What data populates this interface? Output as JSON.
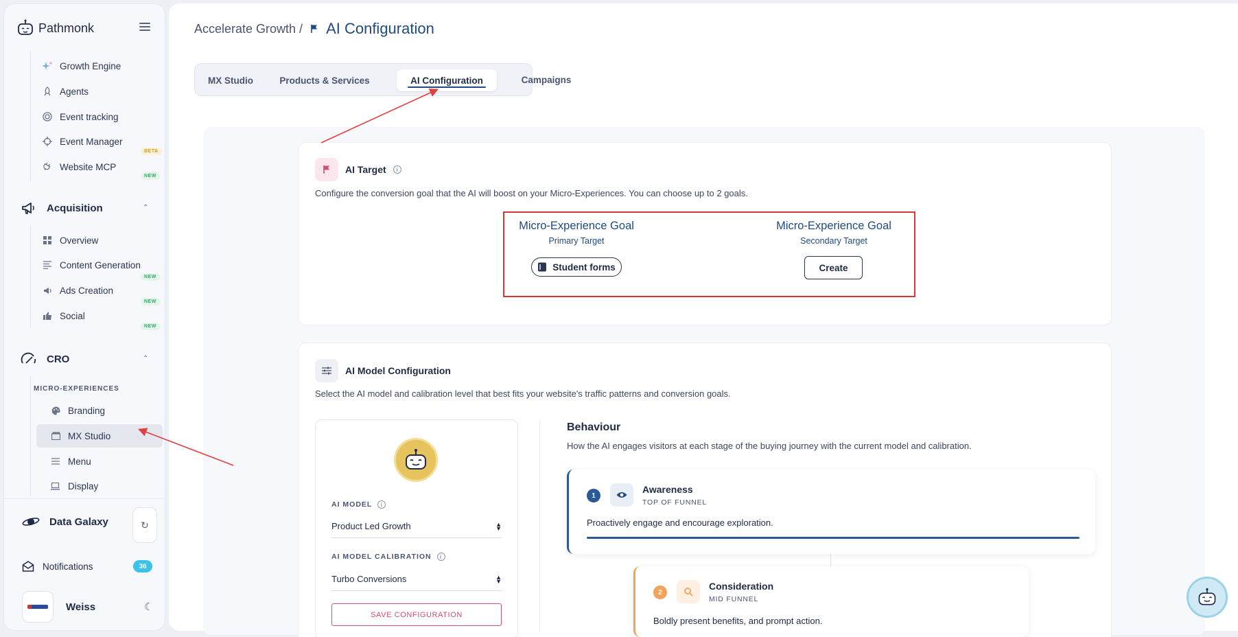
{
  "app": {
    "name": "Pathmonk"
  },
  "sidebar": {
    "top_items": [
      {
        "label": "Growth Engine",
        "icon": "sparkle-icon"
      },
      {
        "label": "Agents",
        "icon": "rocket-icon"
      },
      {
        "label": "Event tracking",
        "icon": "target-icon"
      },
      {
        "label": "Event Manager",
        "icon": "crosshair-icon",
        "badge": "BETA"
      },
      {
        "label": "Website MCP",
        "icon": "plug-icon",
        "badge": "NEW"
      }
    ],
    "acquisition": {
      "title": "Acquisition",
      "items": [
        {
          "label": "Overview",
          "icon": "grid-icon"
        },
        {
          "label": "Content Generation",
          "icon": "lines-icon",
          "badge": "NEW"
        },
        {
          "label": "Ads Creation",
          "icon": "megaphone-icon",
          "badge": "NEW"
        },
        {
          "label": "Social",
          "icon": "thumbs-up-icon",
          "badge": "NEW"
        }
      ]
    },
    "cro": {
      "title": "CRO",
      "section_label": "MICRO-EXPERIENCES",
      "items": [
        {
          "label": "Branding",
          "icon": "palette-icon"
        },
        {
          "label": "MX Studio",
          "icon": "clapper-icon",
          "active": true
        },
        {
          "label": "Menu",
          "icon": "menu-lines-icon"
        },
        {
          "label": "Display",
          "icon": "display-icon"
        }
      ]
    },
    "data_galaxy": "Data Galaxy",
    "notifications": {
      "label": "Notifications",
      "count": "36"
    },
    "user": {
      "name": "Weiss"
    }
  },
  "header": {
    "breadcrumb_parent": "Accelerate Growth /",
    "breadcrumb_current": "AI Configuration"
  },
  "tabs": [
    {
      "label": "MX Studio"
    },
    {
      "label": "Products & Services"
    },
    {
      "label": "AI Configuration",
      "active": true
    },
    {
      "label": "Campaigns"
    }
  ],
  "ai_target": {
    "title": "AI Target",
    "description": "Configure the conversion goal that the AI will boost on your Micro-Experiences. You can choose up to 2 goals.",
    "primary": {
      "title": "Micro-Experience Goal",
      "subtitle": "Primary Target",
      "value": "Student forms"
    },
    "secondary": {
      "title": "Micro-Experience Goal",
      "subtitle": "Secondary Target",
      "button": "Create"
    }
  },
  "ai_model": {
    "title": "AI Model Configuration",
    "description": "Select the AI model and calibration level that best fits your website's traffic patterns and conversion goals.",
    "model_label": "AI MODEL",
    "model_value": "Product Led Growth",
    "calibration_label": "AI MODEL CALIBRATION",
    "calibration_value": "Turbo Conversions",
    "save_label": "SAVE CONFIGURATION"
  },
  "behaviour": {
    "title": "Behaviour",
    "description": "How the AI engages visitors at each stage of the buying journey with the current model and calibration.",
    "stages": [
      {
        "num": "1",
        "name": "Awareness",
        "funnel": "TOP OF FUNNEL",
        "text": "Proactively engage and encourage exploration.",
        "color": "#2a5a96",
        "icon": "eye-icon"
      },
      {
        "num": "2",
        "name": "Consideration",
        "funnel": "MID FUNNEL",
        "text": "Boldly present benefits, and prompt action.",
        "color": "#f0a35a",
        "icon": "magnifier-icon"
      }
    ]
  },
  "colors": {
    "accent": "#1f4a82",
    "danger": "#d93636",
    "save": "#d4506e",
    "badge_new": "#3aa86b",
    "badge_beta": "#d59a2a",
    "notif": "#3ac2e8"
  }
}
